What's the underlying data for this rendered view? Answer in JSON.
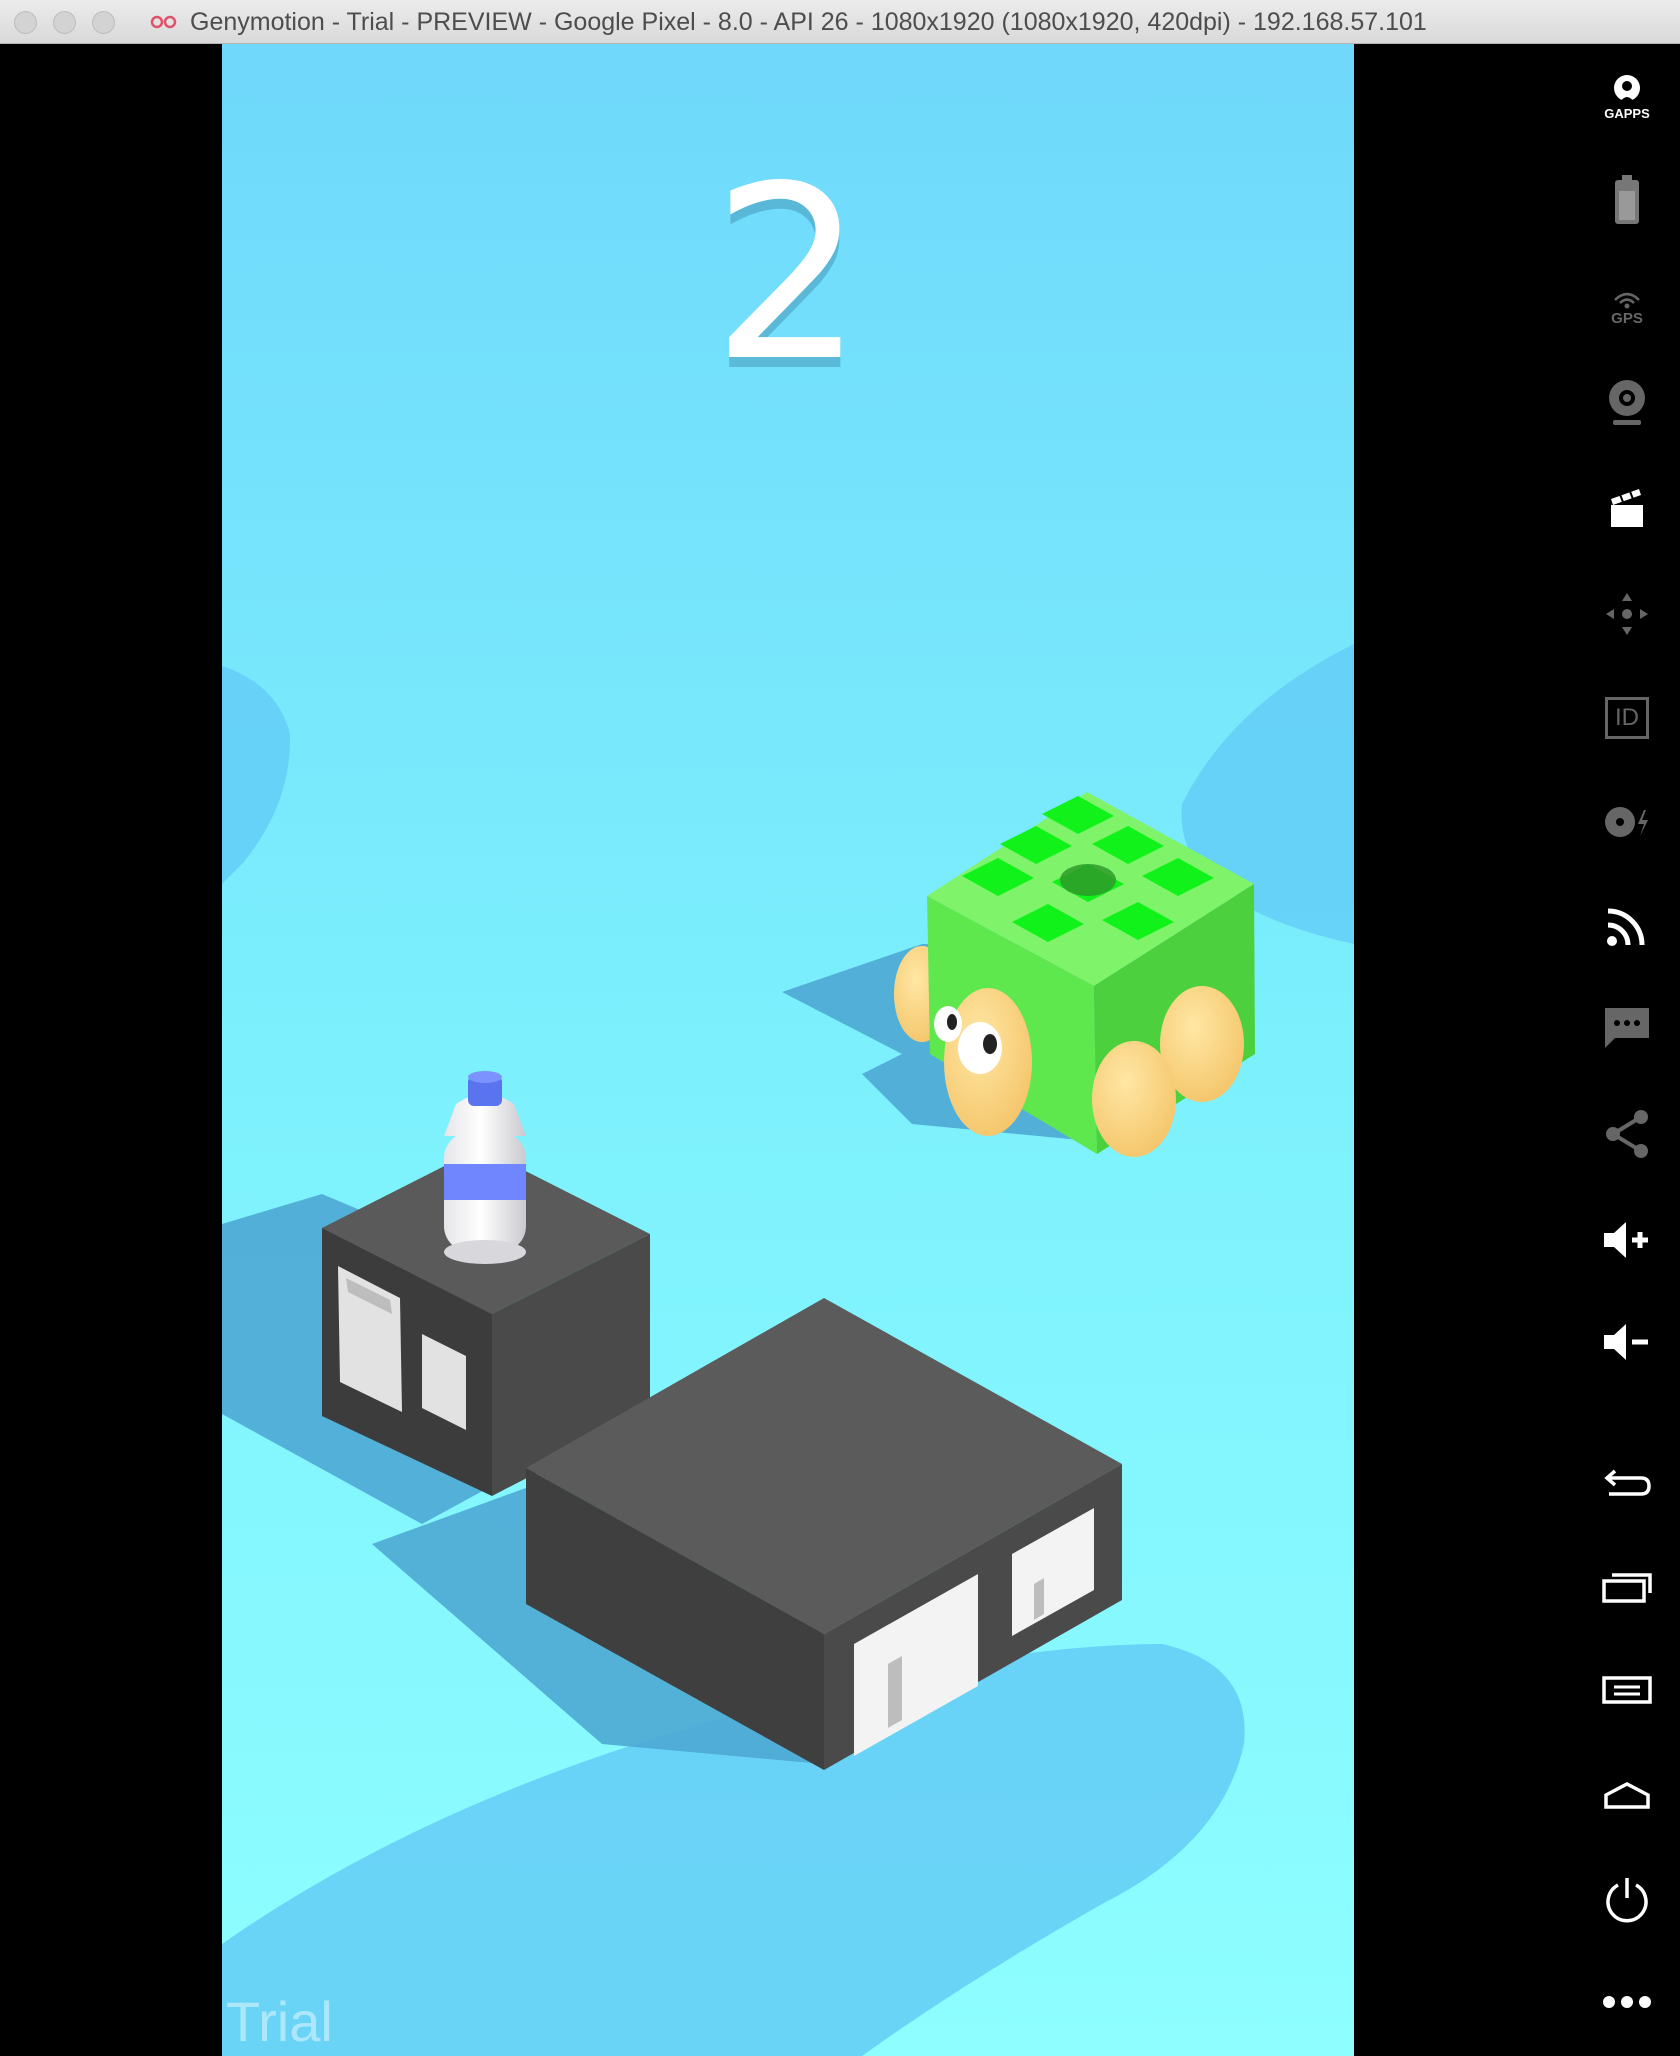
{
  "window": {
    "title": "Genymotion - Trial - PREVIEW - Google Pixel - 8.0 - API 26 - 1080x1920 (1080x1920, 420dpi) - 192.168.57.101"
  },
  "game": {
    "score": "2",
    "watermark": "Trial",
    "colors": {
      "water_light": "#8effff",
      "water_mid": "#6fdcff",
      "water_dark": "#62c8f5",
      "block_top": "#5b5b5b",
      "block_side": "#3f3f3f",
      "turtle_shell": "#5ee84e",
      "turtle_limbs": "#ffd27a",
      "bottle_band": "#6f86ff"
    }
  },
  "toolbar": {
    "items": [
      {
        "name": "gapps-icon",
        "label": "GAPPS"
      },
      {
        "name": "battery-icon"
      },
      {
        "name": "gps-icon",
        "label": "GPS"
      },
      {
        "name": "webcam-icon"
      },
      {
        "name": "screen-capture-icon"
      },
      {
        "name": "remote-control-icon"
      },
      {
        "name": "device-id-icon",
        "label": "ID"
      },
      {
        "name": "disk-io-icon"
      },
      {
        "name": "network-icon"
      },
      {
        "name": "sms-icon"
      },
      {
        "name": "share-icon"
      },
      {
        "name": "volume-up-icon"
      },
      {
        "name": "volume-down-icon"
      },
      {
        "name": "back-icon"
      },
      {
        "name": "recent-apps-icon"
      },
      {
        "name": "menu-icon"
      },
      {
        "name": "home-icon"
      },
      {
        "name": "power-icon"
      },
      {
        "name": "more-icon"
      }
    ]
  }
}
